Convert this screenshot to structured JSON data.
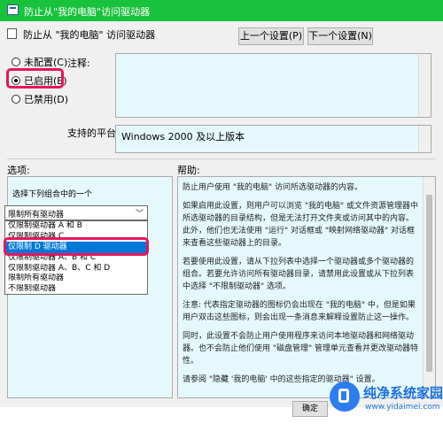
{
  "window": {
    "title": "防止从\"我的电脑\"访问驱动器"
  },
  "header": {
    "policy_title": "防止从 \"我的电脑\" 访问驱动器",
    "prev_button": "上一个设置(P)",
    "next_button": "下一个设置(N)"
  },
  "state_options": {
    "not_configured": "未配置(C)",
    "enabled": "已启用(E)",
    "disabled": "已禁用(D)",
    "selected": "enabled"
  },
  "labels": {
    "comment": "注释:",
    "supported_on": "支持的平台:",
    "options": "选项:",
    "help": "帮助:"
  },
  "supported_platform": "Windows 2000 及以上版本",
  "options": {
    "combo_label": "选择下列组合中的一个",
    "selected_value": "限制所有驱动器",
    "list": [
      "仅限制驱动器 A 和 B",
      "仅限制驱动器 C",
      "仅限制 D 驱动器",
      "仅限制驱动器 A、B 和 C",
      "仅限制驱动器 A、B、C 和 D",
      "限制所有驱动器",
      "不限制驱动器"
    ],
    "highlighted_index": 2
  },
  "help": {
    "paragraphs": [
      "防止用户使用 \"我的电脑\" 访问所选驱动器的内容。",
      "如果启用此设置，则用户可以浏览 \"我的电脑\" 或文件资源管理器中所选驱动器的目录结构，但是无法打开文件夹或访问其中的内容。此外，他们也无法使用 \"运行\" 对话框或 \"映射网络驱动器\" 对话框来查看这些驱动器上的目录。",
      "若要使用此设置，请从下拉列表中选择一个驱动器或多个驱动器的组合。若要允许访问所有驱动器目录，请禁用此设置或从下拉列表中选择 \"不限制驱动器\" 选项。",
      "注意: 代表指定驱动器的图标仍会出现在 \"我的电脑\" 中，但是如果用户双击这些图标，则会出现一条消息来解释设置防止这一操作。",
      "同时，此设置不会防止用户使用程序来访问本地驱动器和网络驱动器。也不会防止他们使用 \"磁盘管理\" 管理单元查看并更改驱动器特性。",
      "请参阅 \"隐藏 '我的电脑' 中的这些指定的驱动器\" 设置。"
    ]
  },
  "footer": {
    "ok_button": "确定"
  },
  "watermark": {
    "name": "纯净系统家园",
    "url": "www.yidaimei.com"
  },
  "colors": {
    "titlebar": "#19c23c",
    "highlight": "#e8155f",
    "selection": "#0078d7",
    "panel": "#e5f9fd"
  }
}
